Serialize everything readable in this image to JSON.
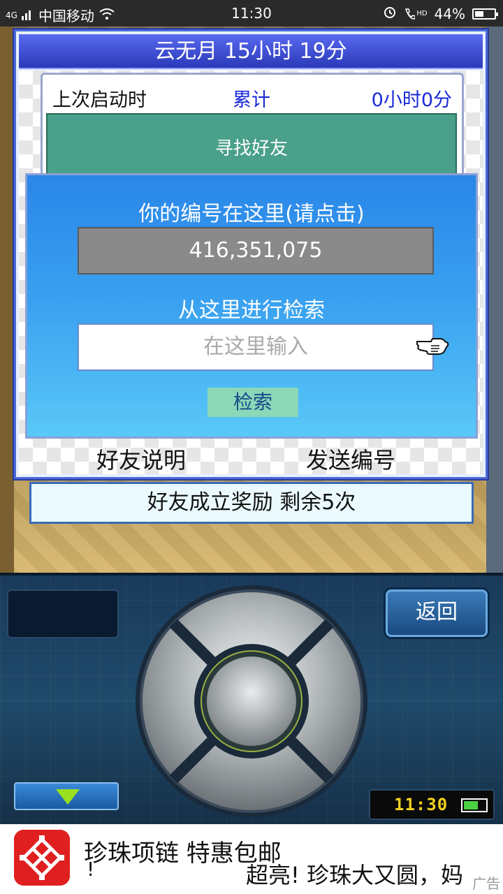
{
  "status_bar": {
    "network": "4G",
    "carrier": "中国移动",
    "time": "11:30",
    "volte": "HD",
    "battery": "44%"
  },
  "dialog": {
    "title": "云无月  15小时 19分",
    "info": {
      "last_start_label": "上次启动时",
      "total_label": "累计",
      "total_value": "0小时0分"
    },
    "find_friend_label": "寻找好友",
    "id_panel": {
      "title": "你的编号在这里(请点击)",
      "id_value": "416,351,075",
      "search_title": "从这里进行检索",
      "search_placeholder": "在这里输入",
      "search_button": "检索"
    },
    "links": {
      "friend_help": "好友说明",
      "send_id": "发送编号"
    }
  },
  "reward_bar": "好友成立奖励  剩余5次",
  "controls": {
    "back_label": "返回",
    "clock": "11:30"
  },
  "ad": {
    "line1": "珍珠项链 特惠包邮",
    "line1_end": "!",
    "line2": "超亮! 珍珠大又圆，妈",
    "mark": "广告"
  },
  "colors": {
    "dialog_title": "#3a4ad8",
    "blue_panel": "#2a86e8",
    "find_bar": "#4aa08a",
    "accent_text": "#1a2ad8"
  }
}
